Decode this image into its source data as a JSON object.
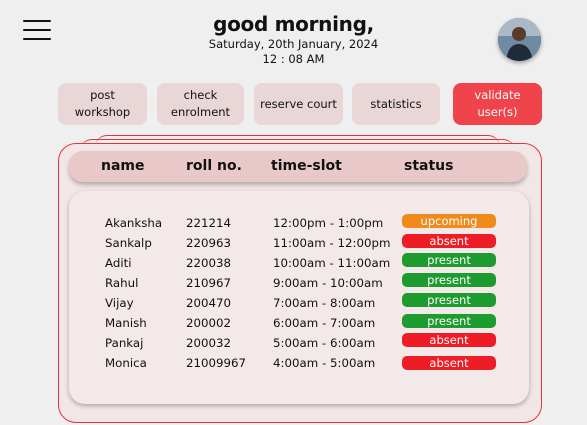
{
  "header": {
    "title": "good morning,",
    "date": "Saturday, 20th January, 2024",
    "time": "12 : 08 AM"
  },
  "icons": {
    "menu": "hamburger-menu-icon",
    "avatar": "user-avatar"
  },
  "nav": [
    {
      "label": "post workshop"
    },
    {
      "label": "check enrolment"
    },
    {
      "label": "reserve court"
    },
    {
      "label": "statistics"
    },
    {
      "label": "validate user(s)"
    }
  ],
  "table": {
    "columns": [
      "name",
      "roll no.",
      "time-slot",
      "status"
    ],
    "rows": [
      {
        "name": "Akanksha",
        "roll": "221214",
        "slot": "12:00pm - 1:00pm",
        "status": "upcoming"
      },
      {
        "name": "Sankalp",
        "roll": "220963",
        "slot": "11:00am - 12:00pm",
        "status": "absent"
      },
      {
        "name": "Aditi",
        "roll": "220038",
        "slot": "10:00am - 11:00am",
        "status": "present"
      },
      {
        "name": "Rahul",
        "roll": "210967",
        "slot": "9:00am - 10:00am",
        "status": "present"
      },
      {
        "name": "Vijay",
        "roll": "200470",
        "slot": "7:00am - 8:00am",
        "status": "present"
      },
      {
        "name": "Manish",
        "roll": "200002",
        "slot": "6:00am - 7:00am",
        "status": "present"
      },
      {
        "name": "Pankaj",
        "roll": "200032",
        "slot": "5:00am - 6:00am",
        "status": "absent"
      },
      {
        "name": "Monica",
        "roll": "21009967",
        "slot": "4:00am - 5:00am",
        "status": "absent"
      }
    ]
  },
  "colors": {
    "upcoming": "#f08a1c",
    "absent": "#ee1c24",
    "present": "#1e9b2e",
    "accent": "#f0444c"
  }
}
